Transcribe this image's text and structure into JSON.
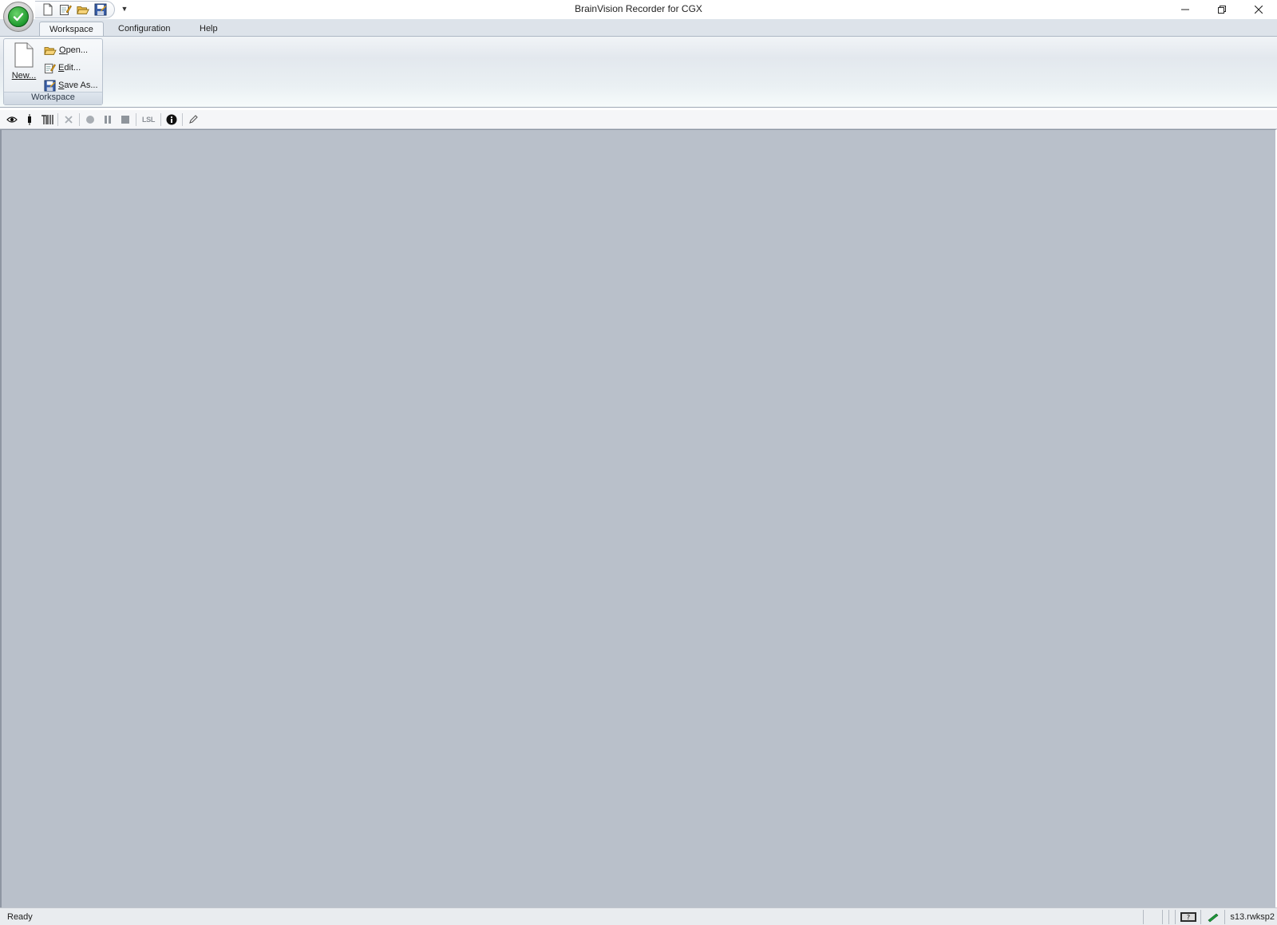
{
  "window": {
    "title": "BrainVision Recorder for CGX"
  },
  "quick_access": {
    "buttons": [
      "new-icon",
      "edit-icon",
      "open-icon",
      "save-as-icon"
    ]
  },
  "ribbon": {
    "tabs": [
      {
        "label": "Workspace",
        "active": true
      },
      {
        "label": "Configuration",
        "active": false
      },
      {
        "label": "Help",
        "active": false
      }
    ],
    "group": {
      "label": "Workspace",
      "new": {
        "mnemonic": "N",
        "rest": "ew..."
      },
      "open": {
        "mnemonic": "O",
        "rest": "pen..."
      },
      "edit": {
        "mnemonic": "E",
        "rest": "dit..."
      },
      "save_as": {
        "mnemonic": "S",
        "rest": "ave As..."
      }
    }
  },
  "toolbar": {
    "lsl_label": "LSL"
  },
  "status": {
    "text": "Ready",
    "file": "s13.rwksp2"
  },
  "colors": {
    "workspace_bg": "#b9c0ca",
    "ribbon_bg": "#e3e8ee",
    "status_bg": "#e9ecef"
  }
}
